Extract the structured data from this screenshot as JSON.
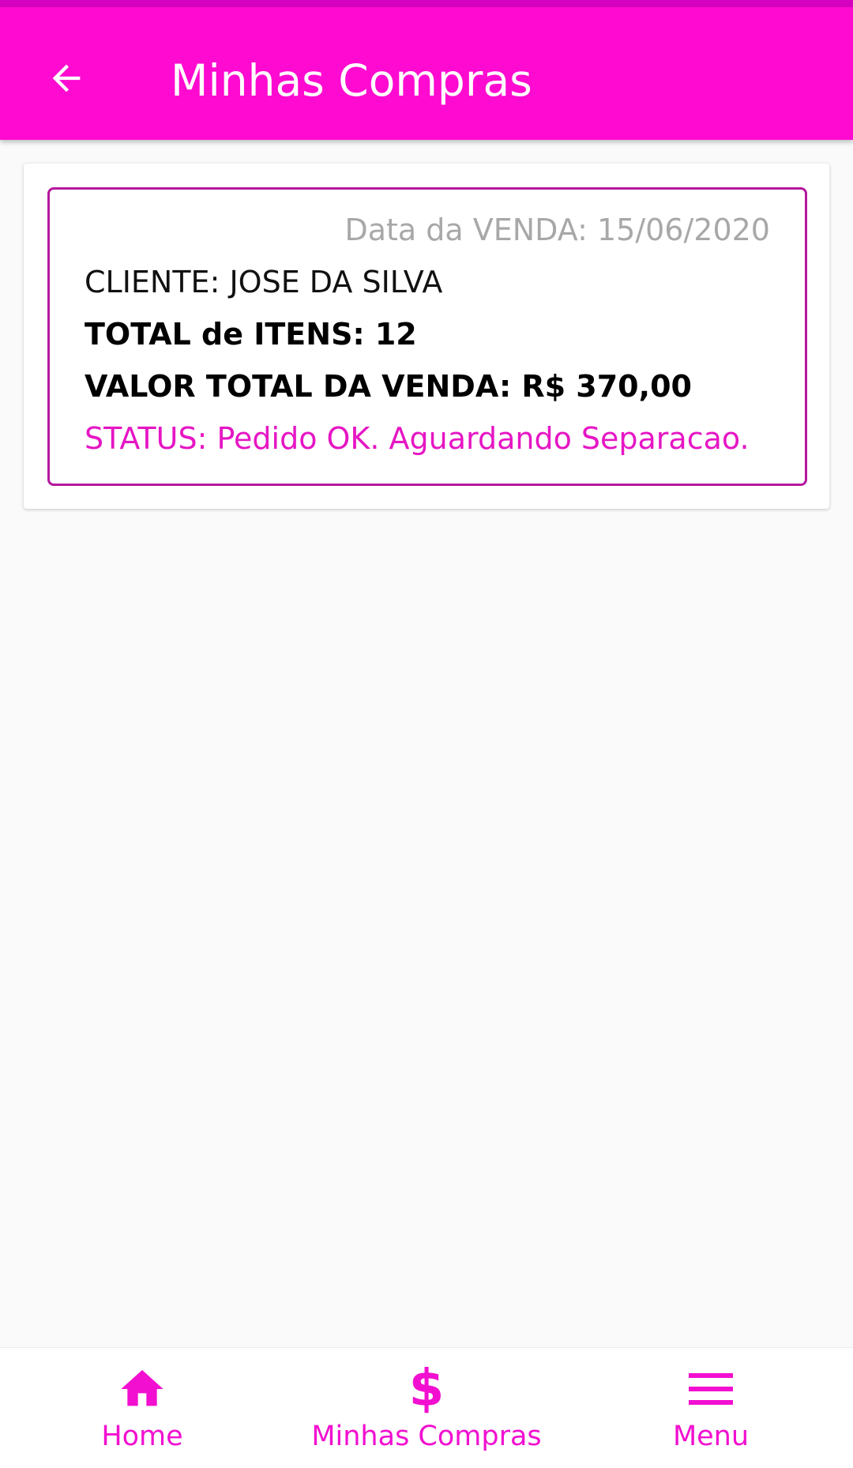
{
  "colors": {
    "app_bar": "#ff0ad0",
    "status_strip": "#d600c0",
    "accent": "#f20fd0",
    "order_border": "#b5179e",
    "status_text": "#e616c4"
  },
  "header": {
    "title": "Minhas Compras",
    "back_icon": "arrow-left-icon"
  },
  "order": {
    "sale_date": "Data da VENDA: 15/06/2020",
    "client": "CLIENTE: JOSE DA SILVA",
    "total_items": "TOTAL de ITENS: 12",
    "total_value": "VALOR TOTAL DA VENDA: R$ 370,00",
    "status": "STATUS: Pedido OK. Aguardando Separacao."
  },
  "bottom_nav": {
    "items": [
      {
        "label": "Home",
        "icon": "home-icon"
      },
      {
        "label": "Minhas Compras",
        "icon": "dollar-icon"
      },
      {
        "label": "Menu",
        "icon": "hamburger-menu-icon"
      }
    ]
  }
}
